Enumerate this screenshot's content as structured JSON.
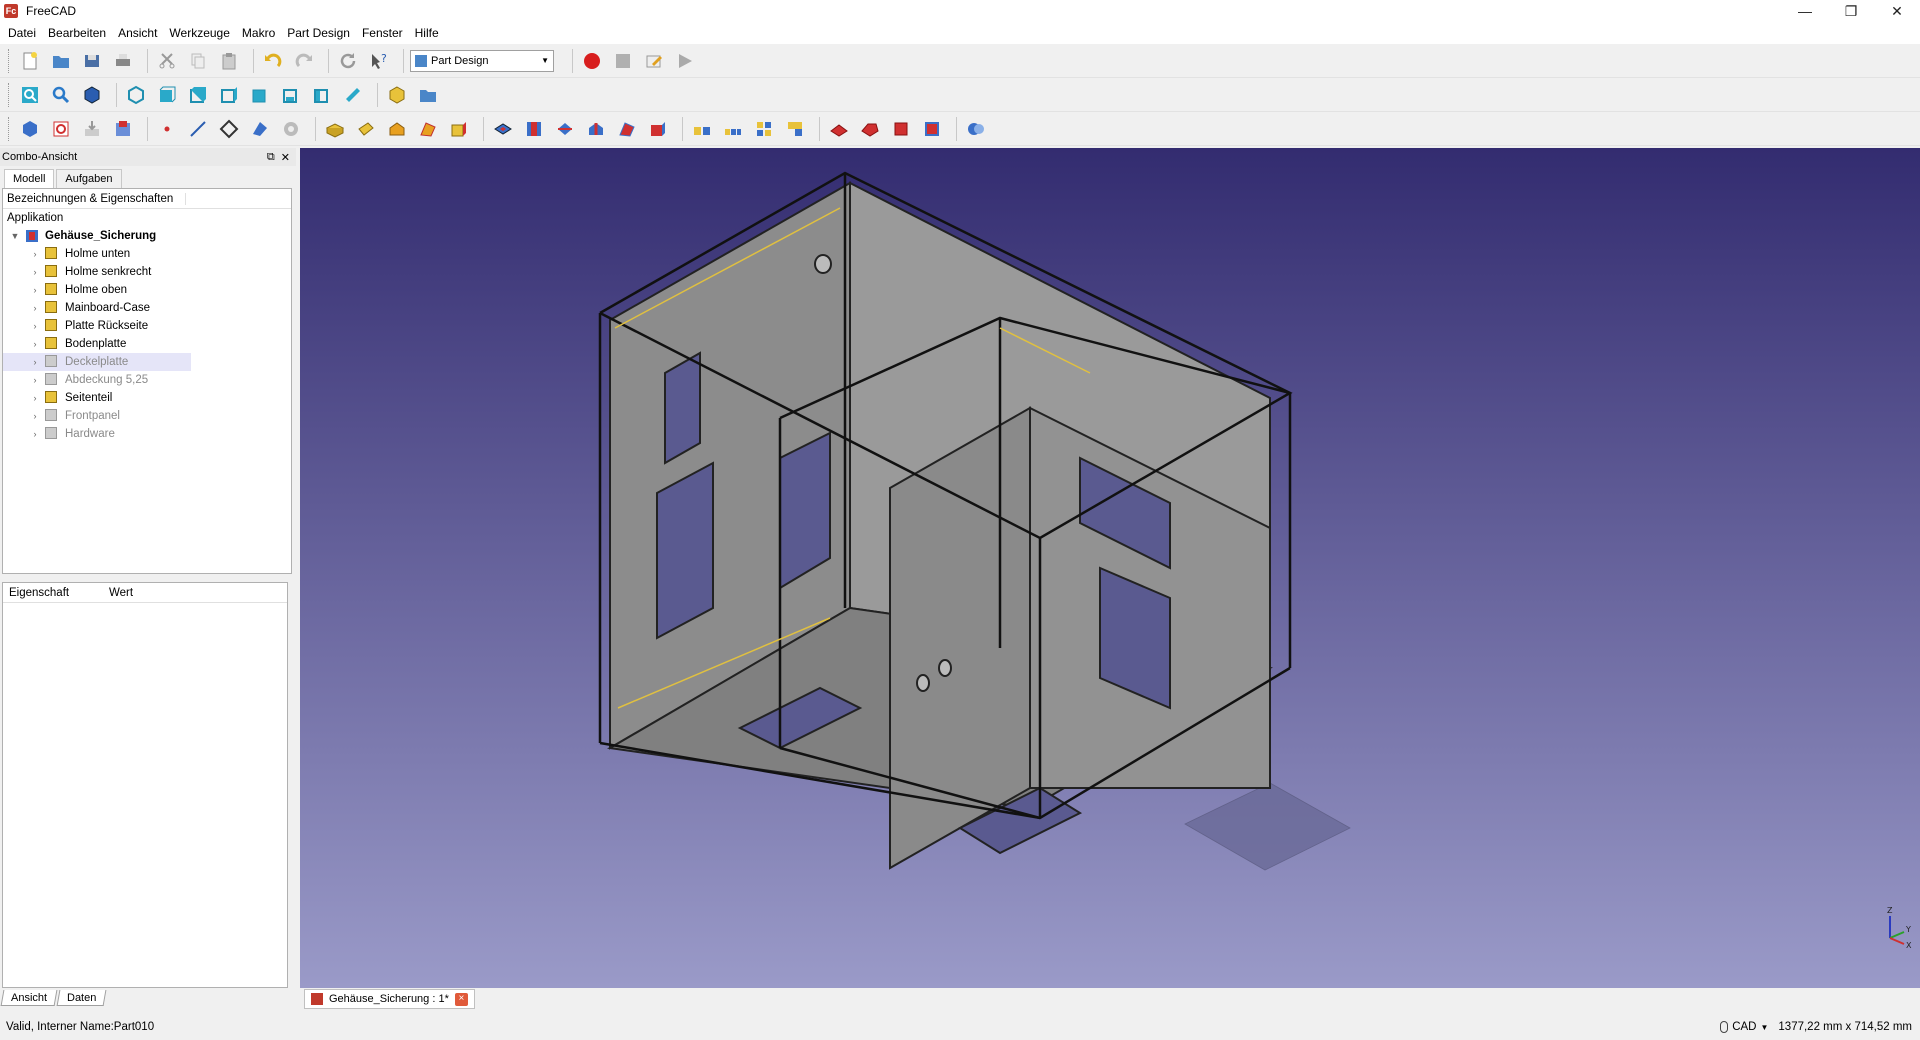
{
  "window": {
    "title": "FreeCAD",
    "logo_text": "Fc",
    "minimize": "—",
    "maximize": "❐",
    "close": "✕"
  },
  "menu": [
    "Datei",
    "Bearbeiten",
    "Ansicht",
    "Werkzeuge",
    "Makro",
    "Part Design",
    "Fenster",
    "Hilfe"
  ],
  "toolbar": {
    "workbench": "Part Design",
    "macro_record_color": "#d81e1e"
  },
  "combo": {
    "title": "Combo-Ansicht",
    "tabs": [
      "Modell",
      "Aufgaben"
    ],
    "active_tab": "Modell",
    "tree_header": "Bezeichnungen & Eigenschaften",
    "app_label": "Applikation",
    "root": "Gehäuse_Sicherung",
    "items": [
      {
        "label": "Holme unten",
        "visible": true
      },
      {
        "label": "Holme senkrecht",
        "visible": true
      },
      {
        "label": "Holme oben",
        "visible": true
      },
      {
        "label": "Mainboard-Case",
        "visible": true
      },
      {
        "label": "Platte Rückseite",
        "visible": true
      },
      {
        "label": "Bodenplatte",
        "visible": true
      },
      {
        "label": "Deckelplatte",
        "visible": false,
        "selected": true
      },
      {
        "label": "Abdeckung 5,25",
        "visible": false
      },
      {
        "label": "Seitenteil",
        "visible": true
      },
      {
        "label": "Frontpanel",
        "visible": false
      },
      {
        "label": "Hardware",
        "visible": false
      }
    ],
    "prop_cols": [
      "Eigenschaft",
      "Wert"
    ],
    "bottom_tabs": [
      "Ansicht",
      "Daten"
    ]
  },
  "document_tab": {
    "label": "Gehäuse_Sicherung : 1*"
  },
  "status": {
    "message": "Valid, Interner Name:Part010",
    "nav_style": "CAD",
    "dimensions": "1377,22 mm x 714,52 mm"
  },
  "colors": {
    "viewport_top": "#332c70",
    "viewport_bottom": "#9a9ac8",
    "part_gray": "#8c8c8c",
    "body_yellow": "#e8c23a",
    "selection": "#e5e5f8"
  },
  "axis": {
    "x": "X",
    "y": "Y",
    "z": "Z"
  }
}
